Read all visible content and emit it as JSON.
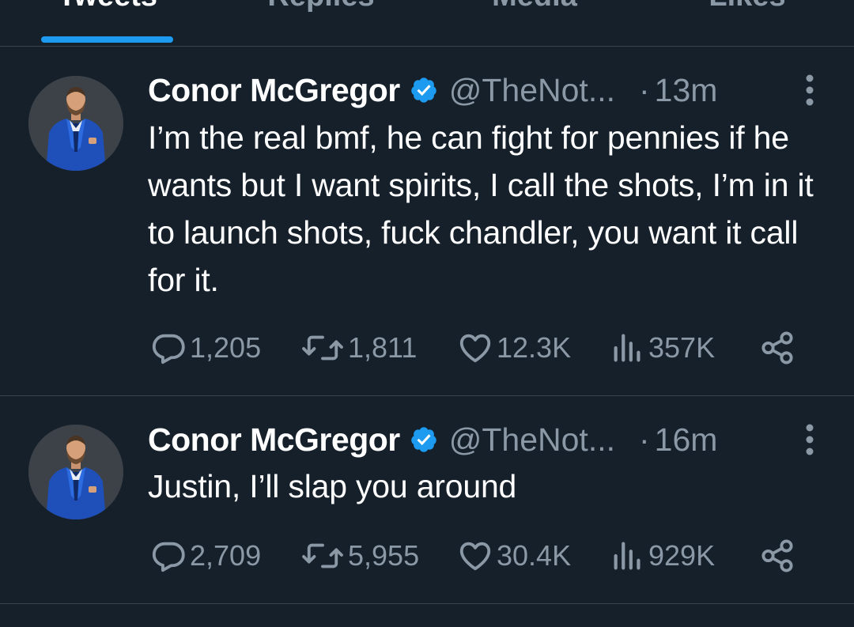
{
  "tabs": [
    {
      "label": "Tweets",
      "active": true
    },
    {
      "label": "Replies",
      "active": false
    },
    {
      "label": "Media",
      "active": false
    },
    {
      "label": "Likes",
      "active": false
    }
  ],
  "tweets": [
    {
      "name": "Conor McGregor",
      "verified_icon": "verified-badge-icon",
      "handle": "@TheNot...",
      "dot": "·",
      "time": "13m",
      "text": "I’m the real bmf, he can fight for pennies if he wants but I want spirits, I call the shots, I’m in it to launch shots, fuck chandler, you want it call for it.",
      "replies": "1,205",
      "retweets": "1,811",
      "likes": "12.3K",
      "views": "357K"
    },
    {
      "name": "Conor McGregor",
      "verified_icon": "verified-badge-icon",
      "handle": "@TheNot...",
      "dot": "·",
      "time": "16m",
      "text": "Justin, I’ll slap you around",
      "replies": "2,709",
      "retweets": "5,955",
      "likes": "30.4K",
      "views": "929K"
    }
  ],
  "colors": {
    "background": "#15202b",
    "accent": "#1d9bf0",
    "muted": "#8b98a5",
    "divider": "#38444d"
  }
}
